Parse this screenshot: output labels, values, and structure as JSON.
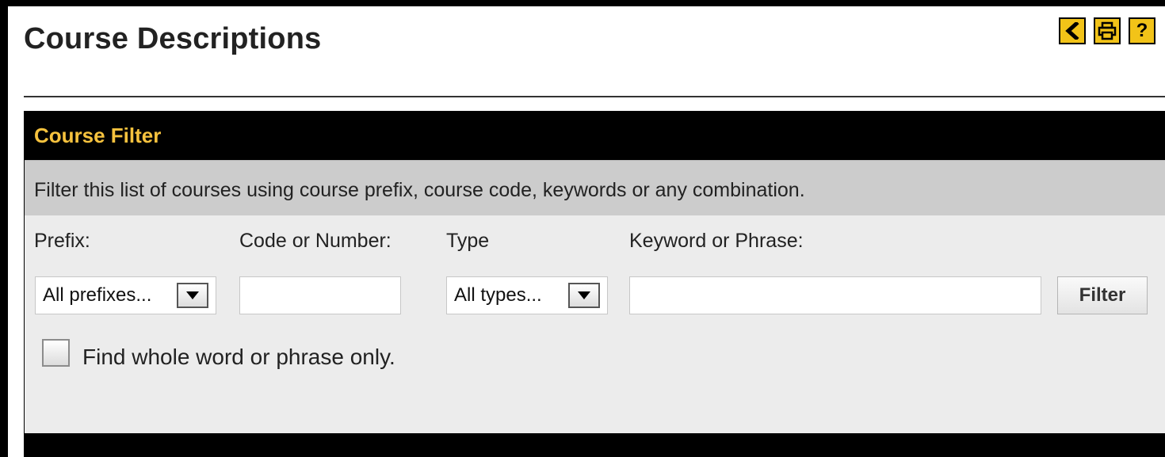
{
  "page": {
    "title": "Course Descriptions",
    "tools": [
      {
        "icon": "share-icon",
        "label": "<"
      },
      {
        "icon": "print-icon",
        "label": "print"
      },
      {
        "icon": "help-icon",
        "label": "?"
      }
    ]
  },
  "filter": {
    "heading": "Course Filter",
    "description": "Filter this list of courses using course prefix, course code, keywords or any combination.",
    "labels": {
      "prefix": "Prefix:",
      "code": "Code or Number:",
      "type": "Type",
      "keyword": "Keyword or Phrase:"
    },
    "prefix_select": {
      "selected": "All prefixes..."
    },
    "code_input": {
      "value": ""
    },
    "type_select": {
      "selected": "All types..."
    },
    "keyword_input": {
      "value": ""
    },
    "button_label": "Filter",
    "checkbox_label": "Find whole word or phrase only.",
    "checkbox_checked": false
  },
  "colors": {
    "accent": "#f2c318",
    "header_text": "#f6c23e",
    "panel_bg": "#ececec",
    "desc_bg": "#cccccc"
  }
}
